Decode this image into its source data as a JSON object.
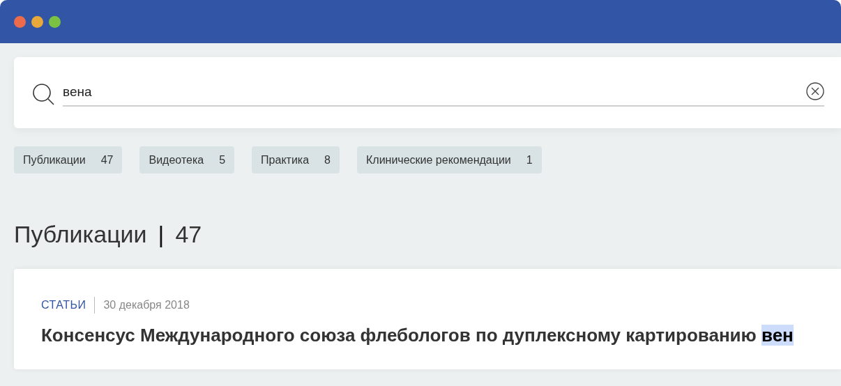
{
  "search": {
    "value": "вена"
  },
  "tabs": [
    {
      "label": "Публикации",
      "count": "47",
      "selected": false
    },
    {
      "label": "Видеотека",
      "count": "5",
      "selected": false
    },
    {
      "label": "Практика",
      "count": "8",
      "selected": false
    },
    {
      "label": "Клинические рекомендации",
      "count": "1",
      "selected": false
    }
  ],
  "section": {
    "title": "Публикации",
    "separator": "|",
    "count": "47"
  },
  "results": [
    {
      "category": "СТАТЬИ",
      "date": "30 декабря 2018",
      "title": [
        {
          "text": "Консенсус Международного союза флебологов по дуплексному картированию ",
          "highlighted": false
        },
        {
          "text": "вен",
          "highlighted": true
        }
      ]
    }
  ]
}
